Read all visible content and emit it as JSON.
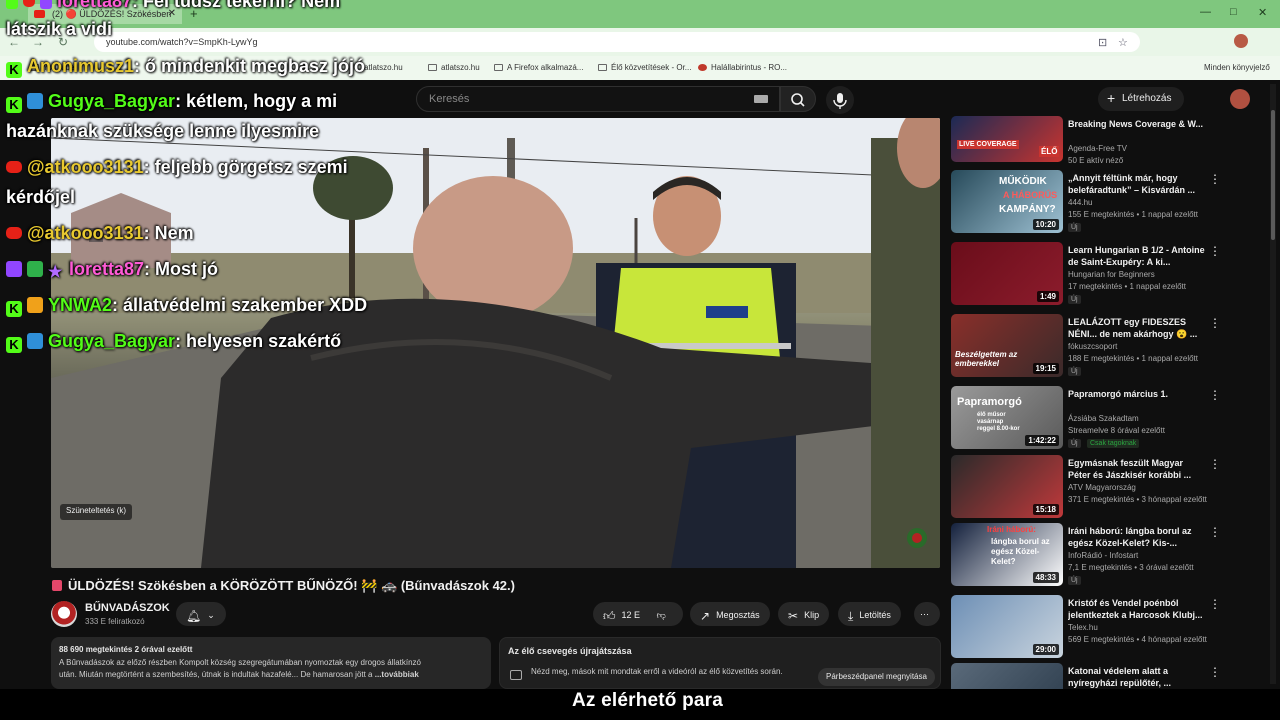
{
  "browser": {
    "tab_title": "(2) 🔴 ÜLDÖZÉS! Szökésben",
    "tab_close": "✕",
    "new_tab": "+",
    "url": "youtube.com/watch?v=SmpKh-LywYg",
    "bookmarks": [
      "YouTube",
      "atlatszo.hu",
      "atlatszo.hu",
      "A Firefox alkalmazá...",
      "Élő közvetítések - Or...",
      "Halállabirintus - RO..."
    ],
    "other_bookmarks": "Minden könyvjelző"
  },
  "youtube": {
    "search_placeholder": "Keresés",
    "create_label": "Létrehozás"
  },
  "chat": [
    {
      "badges": [
        "kick",
        "arrow"
      ],
      "user": "Gugya_Bagyar",
      "color": "green",
      "text": ": kétlem, hogy a mi",
      "cont": "hazánknak szüksége lenne ilyesmire"
    },
    {
      "badges": [
        "yt"
      ],
      "user": "@atkooo3131",
      "color": "yellow",
      "text": ": feljebb görgetsz szemi",
      "cont": "kérdőjel"
    },
    {
      "badges": [
        "yt"
      ],
      "user": "@atkooo3131",
      "color": "yellow",
      "text": ": Nem",
      "cont": ""
    },
    {
      "badges": [
        "twitch",
        "green",
        "star"
      ],
      "user": "loretta87",
      "color": "pink",
      "text": ": Most jó",
      "cont": ""
    },
    {
      "badges": [
        "kick",
        "crown"
      ],
      "user": "YNWA2",
      "color": "green",
      "text": ": állatvédelmi szakember XDD",
      "cont": ""
    },
    {
      "badges": [
        "kick",
        "arrow"
      ],
      "user": "Gugya_Bagyar",
      "color": "green",
      "text": ": helyesen szakértő",
      "cont": ""
    }
  ],
  "chat_top": {
    "line1_user": "loretta87",
    "line1_text": ": Fel tudsz tekerni? Nem",
    "line1_cont": "látszik a vidi",
    "line2_user": "Anonimusz1",
    "line2_text": ": ő mindenkit megbasz jójó"
  },
  "video": {
    "pause_hint": "Szüneteltetés (k)",
    "title": "ÜLDÖZÉS! Szökésben a KÖRÖZÖTT BŰNÖZŐ! 🚧 🚓 (Bűnvadászok 42.)",
    "channel": "BŰNVADÁSZOK",
    "subscribers": "333 E feliratkozó",
    "likes": "12 E",
    "share": "Megosztás",
    "clip": "Klip",
    "download": "Letöltés",
    "more": "⋯"
  },
  "description": {
    "meta": "88 690 megtekintés  2 órával ezelőtt",
    "line1": "A Bűnvadászok az előző részben Kompolt község szegregátumában nyomoztak egy drogos állatkínzó",
    "line2": "után. Miután megtörtént a szembesítés, útnak is indultak hazafelé... De hamarosan jött a",
    "more": "...továbbiak"
  },
  "chat_replay": {
    "title": "Az élő csevegés újrajátszása",
    "desc": "Nézd meg, mások mit mondtak erről a videóról az élő közvetítés során.",
    "button": "Párbeszédpanel megnyitása"
  },
  "caption": "Az elérhető para",
  "recommendations": [
    {
      "title": "Breaking News Coverage & W...",
      "channel": "Agenda-Free TV",
      "meta": "50 E aktív néző",
      "duration": "",
      "badge": "",
      "colors": [
        "#1b2a55",
        "#c9342f"
      ]
    },
    {
      "title": "„Annyit féltünk már, hogy belefáradtunk” – Kisvárdán ...",
      "channel": "444.hu",
      "meta": "155 E megtekintés • 1 nappal ezelőtt",
      "duration": "10:20",
      "badge": "Új",
      "colors": [
        "#274a5a",
        "#9fc2d4"
      ]
    },
    {
      "title": "Learn Hungarian B 1/2 - Antoine de Saint-Exupéry: A ki...",
      "channel": "Hungarian for Beginners",
      "meta": "17 megtekintés • 1 nappal ezelőtt",
      "duration": "1:49",
      "badge": "Új",
      "colors": [
        "#6a0d1a",
        "#8c1c2c"
      ]
    },
    {
      "title": "LEALÁZOTT egy FIDESZES NÉNI... de nem akárhogy 😮 ...",
      "channel": "fókuszcsoport",
      "meta": "188 E megtekintés • 1 nappal ezelőtt",
      "duration": "19:15",
      "badge": "Új",
      "colors": [
        "#8a2f2a",
        "#3a2a2a"
      ]
    },
    {
      "title": "Papramorgó március 1.",
      "channel": "Ázsiába Szakadtam",
      "meta": "Streamelve 8 órával ezelőtt",
      "duration": "1:42:22",
      "badge": "Új",
      "members": "Csak tagoknak",
      "colors": [
        "#9a9a9a",
        "#5a5a5a"
      ]
    },
    {
      "title": "Egymásnak feszült Magyar Péter és Jászkisér korábbi ...",
      "channel": "ATV Magyarország",
      "meta": "371 E megtekintés • 3 hónappal ezelőtt",
      "duration": "15:18",
      "badge": "",
      "colors": [
        "#2a2a2a",
        "#c0393b"
      ]
    },
    {
      "title": "Iráni háború: lángba borul az egész Közel-Kelet? Kis-...",
      "channel": "InfoRádió - Infostart",
      "meta": "7,1 E megtekintés • 3 órával ezelőtt",
      "duration": "48:33",
      "badge": "Új",
      "colors": [
        "#14213d",
        "#ffffff"
      ]
    },
    {
      "title": "Kristóf és Vendel poénból jelentkeztek a Harcosok Klubj...",
      "channel": "Telex.hu",
      "meta": "569 E megtekintés • 4 hónappal ezelőtt",
      "duration": "29:00",
      "badge": "",
      "colors": [
        "#6d8fb5",
        "#c9d4de"
      ]
    },
    {
      "title": "Katonai védelem alatt a nyíregyházi repülőtér, ...",
      "channel": "",
      "meta": "",
      "duration": "",
      "badge": "",
      "colors": [
        "#5a6a7a",
        "#2a3a4a"
      ]
    }
  ],
  "thumb_texts": {
    "t1_live": "LIVE COVERAGE",
    "t1_elo": "ÉLŐ",
    "t2_a": "MŰKÖDIK",
    "t2_b": "A HÁBORÚS",
    "t2_c": "KAMPÁNY?",
    "t4": "Beszélgettem az emberekkel",
    "t5_a": "Papramorgó",
    "t5_b": "élő műsor vasárnap reggel 8.00-kor",
    "t7_a": "Iráni háború:",
    "t7_b": "lángba borul az egész Közel-Kelet?"
  }
}
